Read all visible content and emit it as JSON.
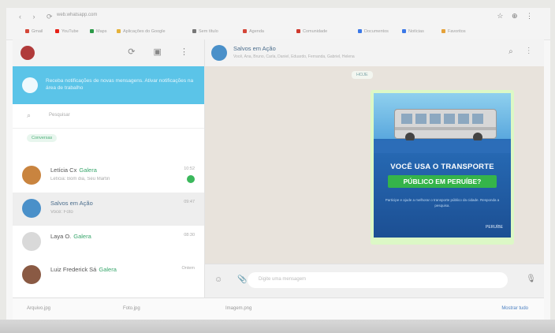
{
  "browser": {
    "url": "web.whatsapp.com",
    "nav_glyphs": "‹ ›  ⟳",
    "right_glyphs": "☆ ⊕ ⋮",
    "bookmarks": [
      {
        "label": "Gmail",
        "color": "#d44638"
      },
      {
        "label": "YouTube",
        "color": "#e62117"
      },
      {
        "label": "Maps",
        "color": "#2b9a48"
      },
      {
        "label": "Aplicações do Google",
        "color": "#e5b23a"
      },
      {
        "label": "Sem título",
        "color": "#777777"
      },
      {
        "label": "Agenda",
        "color": "#d44638"
      },
      {
        "label": "Comunidade",
        "color": "#cf3a2e"
      },
      {
        "label": "Documentos",
        "color": "#3b78e7"
      },
      {
        "label": "Notícias",
        "color": "#3b78e7"
      },
      {
        "label": "Favoritos",
        "color": "#e5a23a"
      }
    ]
  },
  "sidebar": {
    "head_icons": "⟳ ▣ ⋮",
    "notification": "Receba notificações de novas mensagens. Ativar notificações na área de trabalho",
    "search_icon": "search-icon",
    "search_placeholder": "Pesquisar",
    "filter_chip": "Conversas",
    "chats": [
      {
        "name": "Letícia Cx",
        "tag": "Galera",
        "preview": "Letícia: Bom dia, Seu Martin",
        "time": "10:52",
        "avatar_color": "#c9843f",
        "unread": true
      },
      {
        "name": "Salvos em Ação",
        "tag": "",
        "preview": "Você: Foto",
        "time": "09:47",
        "avatar_color": "#4a90c9",
        "unread": false
      },
      {
        "name": "Laya O.",
        "tag": "Galera",
        "preview": "",
        "time": "08:30",
        "avatar_color": "#d9d9d9",
        "unread": false
      },
      {
        "name": "Luiz Frederick Sá",
        "tag": "Galera",
        "preview": "",
        "time": "Ontem",
        "avatar_color": "#8a5a44",
        "unread": false
      }
    ]
  },
  "chat": {
    "group_name": "Salvos em Ação",
    "members": "Você, Ana, Bruno, Carla, Daniel, Eduardo, Fernanda, Gabriel, Helena",
    "head_icons": "⌕ ⋮",
    "date_chip": "HOJE",
    "poster": {
      "headline": "VOCÊ USA O TRANSPORTE",
      "headline2": "PÚBLICO EM PERUÍBE?",
      "subtext": "Participe e ajude a melhorar o transporte público da cidade. Responda a pesquisa.",
      "logos": "PERUÍBE"
    },
    "composer_icons": "☺ 📎",
    "composer_placeholder": "Digite uma mensagem",
    "mic_glyph": "🎙"
  },
  "downloads": [
    {
      "label": "Arquivo.jpg"
    },
    {
      "label": "Foto.jpg"
    },
    {
      "label": "Imagem.png"
    }
  ],
  "downloads_link": "Mostrar tudo"
}
